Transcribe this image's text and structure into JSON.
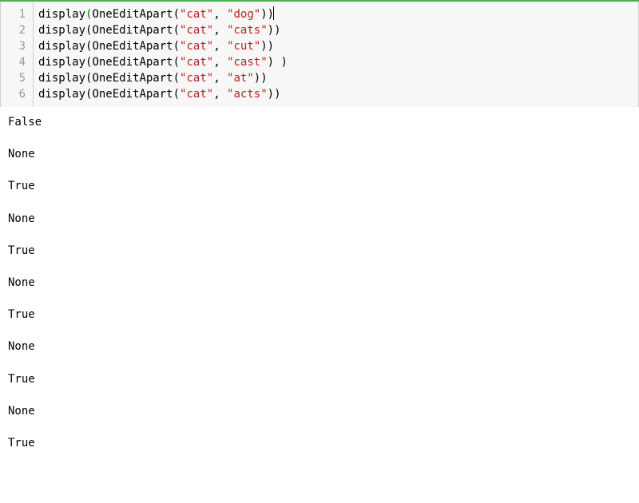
{
  "cell": {
    "lines": [
      {
        "num": "1",
        "func": "display",
        "call": "OneEditApart",
        "arg1": "\"cat\"",
        "comma": ", ",
        "arg2": "\"dog\"",
        "close": "))",
        "extra_space": "",
        "has_cursor": true
      },
      {
        "num": "2",
        "func": "display",
        "call": "OneEditApart",
        "arg1": "\"cat\"",
        "comma": ", ",
        "arg2": "\"cats\"",
        "close": "))",
        "extra_space": "",
        "has_cursor": false
      },
      {
        "num": "3",
        "func": "display",
        "call": "OneEditApart",
        "arg1": "\"cat\"",
        "comma": ", ",
        "arg2": "\"cut\"",
        "close": "))",
        "extra_space": "",
        "has_cursor": false
      },
      {
        "num": "4",
        "func": "display",
        "call": "OneEditApart",
        "arg1": "\"cat\"",
        "comma": ", ",
        "arg2": "\"cast\"",
        "close": ") )",
        "extra_space": "",
        "has_cursor": false
      },
      {
        "num": "5",
        "func": "display",
        "call": "OneEditApart",
        "arg1": "\"cat\"",
        "comma": ", ",
        "arg2": "\"at\"",
        "close": "))",
        "extra_space": "",
        "has_cursor": false
      },
      {
        "num": "6",
        "func": "display",
        "call": "OneEditApart",
        "arg1": "\"cat\"",
        "comma": ", ",
        "arg2": "\"acts\"",
        "close": "))",
        "extra_space": "",
        "has_cursor": false
      }
    ]
  },
  "output": [
    "False",
    "None",
    "True",
    "None",
    "True",
    "None",
    "True",
    "None",
    "True",
    "None",
    "True"
  ]
}
